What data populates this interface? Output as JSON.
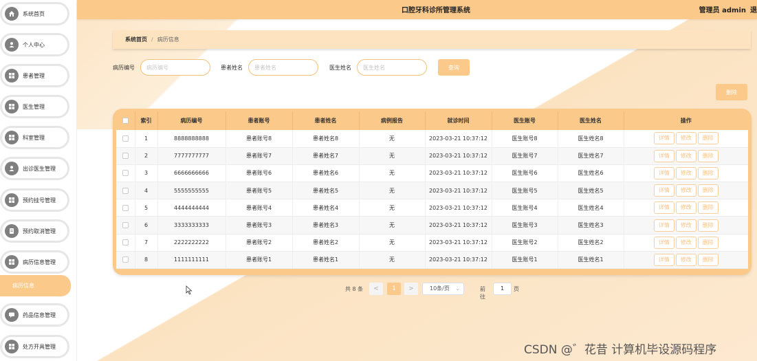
{
  "header": {
    "title": "口腔牙科诊所管理系统",
    "user": "管理员 admin",
    "logout": "退"
  },
  "sidebar": {
    "items": [
      {
        "label": "系统首页",
        "icon": "home-icon"
      },
      {
        "label": "个人中心",
        "icon": "user-icon"
      },
      {
        "label": "患者管理",
        "icon": "grid-icon"
      },
      {
        "label": "医生管理",
        "icon": "grid-icon"
      },
      {
        "label": "科室管理",
        "icon": "grid-icon"
      },
      {
        "label": "出诊医生管理",
        "icon": "user-icon"
      },
      {
        "label": "预约挂号管理",
        "icon": "grid-icon"
      },
      {
        "label": "预约取消管理",
        "icon": "doc-icon"
      },
      {
        "label": "病历信息管理",
        "icon": "grid-icon"
      },
      {
        "label": "药品信息管理",
        "icon": "chat-icon"
      },
      {
        "label": "处方开具管理",
        "icon": "grid-icon"
      }
    ],
    "active_sub": "病历信息"
  },
  "breadcrumb": {
    "home": "系统首页",
    "separator": "/",
    "current": "病历信息"
  },
  "search": {
    "record_no_label": "病历编号",
    "record_no_placeholder": "病历编号",
    "patient_name_label": "患者姓名",
    "patient_name_placeholder": "患者姓名",
    "doctor_name_label": "医生姓名",
    "doctor_name_placeholder": "医生姓名",
    "query_button": "查询"
  },
  "toolbar": {
    "delete_button": "删除"
  },
  "table": {
    "headers": [
      "索引",
      "病历编号",
      "患者账号",
      "患者姓名",
      "病例报告",
      "就诊时间",
      "医生账号",
      "医生姓名",
      "操作"
    ],
    "rows": [
      {
        "index": "1",
        "record_no": "8888888888",
        "patient_account": "患者账号8",
        "patient_name": "患者姓名8",
        "report": "无",
        "visit_time": "2023-03-21 10:37:12",
        "doctor_account": "医生账号8",
        "doctor_name": "医生姓名8"
      },
      {
        "index": "2",
        "record_no": "7777777777",
        "patient_account": "患者账号7",
        "patient_name": "患者姓名7",
        "report": "无",
        "visit_time": "2023-03-21 10:37:12",
        "doctor_account": "医生账号7",
        "doctor_name": "医生姓名7"
      },
      {
        "index": "3",
        "record_no": "6666666666",
        "patient_account": "患者账号6",
        "patient_name": "患者姓名6",
        "report": "无",
        "visit_time": "2023-03-21 10:37:12",
        "doctor_account": "医生账号6",
        "doctor_name": "医生姓名6"
      },
      {
        "index": "4",
        "record_no": "5555555555",
        "patient_account": "患者账号5",
        "patient_name": "患者姓名5",
        "report": "无",
        "visit_time": "2023-03-21 10:37:12",
        "doctor_account": "医生账号5",
        "doctor_name": "医生姓名5"
      },
      {
        "index": "5",
        "record_no": "4444444444",
        "patient_account": "患者账号4",
        "patient_name": "患者姓名4",
        "report": "无",
        "visit_time": "2023-03-21 10:37:12",
        "doctor_account": "医生账号4",
        "doctor_name": "医生姓名4"
      },
      {
        "index": "6",
        "record_no": "3333333333",
        "patient_account": "患者账号3",
        "patient_name": "患者姓名3",
        "report": "无",
        "visit_time": "2023-03-21 10:37:12",
        "doctor_account": "医生账号3",
        "doctor_name": "医生姓名3"
      },
      {
        "index": "7",
        "record_no": "2222222222",
        "patient_account": "患者账号2",
        "patient_name": "患者姓名2",
        "report": "无",
        "visit_time": "2023-03-21 10:37:12",
        "doctor_account": "医生账号2",
        "doctor_name": "医生姓名2"
      },
      {
        "index": "8",
        "record_no": "1111111111",
        "patient_account": "患者账号1",
        "patient_name": "患者姓名1",
        "report": "无",
        "visit_time": "2023-03-21 10:37:12",
        "doctor_account": "医生账号1",
        "doctor_name": "医生姓名1"
      }
    ],
    "actions": {
      "detail": "详情",
      "edit": "修改",
      "delete": "删除"
    }
  },
  "pagination": {
    "total": "共 8 条",
    "prev": "<",
    "current_page": "1",
    "next": ">",
    "page_size": "10条/页",
    "goto_label": "前往",
    "goto_value": "1",
    "page_suffix": "页"
  },
  "watermark": "CSDN @゛花昔 计算机毕设源码程序",
  "colors": {
    "accent": "#fbc98a",
    "accent_light": "#fde3c0",
    "action_text": "#f8c283"
  }
}
